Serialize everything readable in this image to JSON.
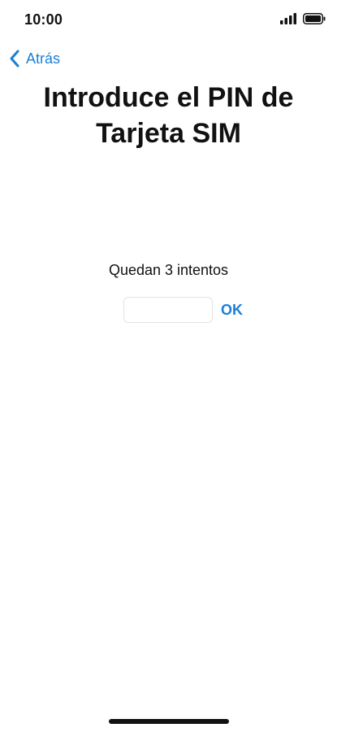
{
  "status_bar": {
    "time": "10:00",
    "signal_icon": "signal-bars-icon",
    "battery_icon": "battery-full-icon"
  },
  "nav": {
    "back_label": "Atrás",
    "back_icon": "chevron-left-icon"
  },
  "title": "Introduce el PIN de Tarjeta SIM",
  "attempts_text": "Quedan 3 intentos",
  "pin": {
    "value": "",
    "placeholder": ""
  },
  "ok_label": "OK",
  "colors": {
    "accent": "#1a7fd6",
    "text": "#111111",
    "background": "#ffffff"
  }
}
